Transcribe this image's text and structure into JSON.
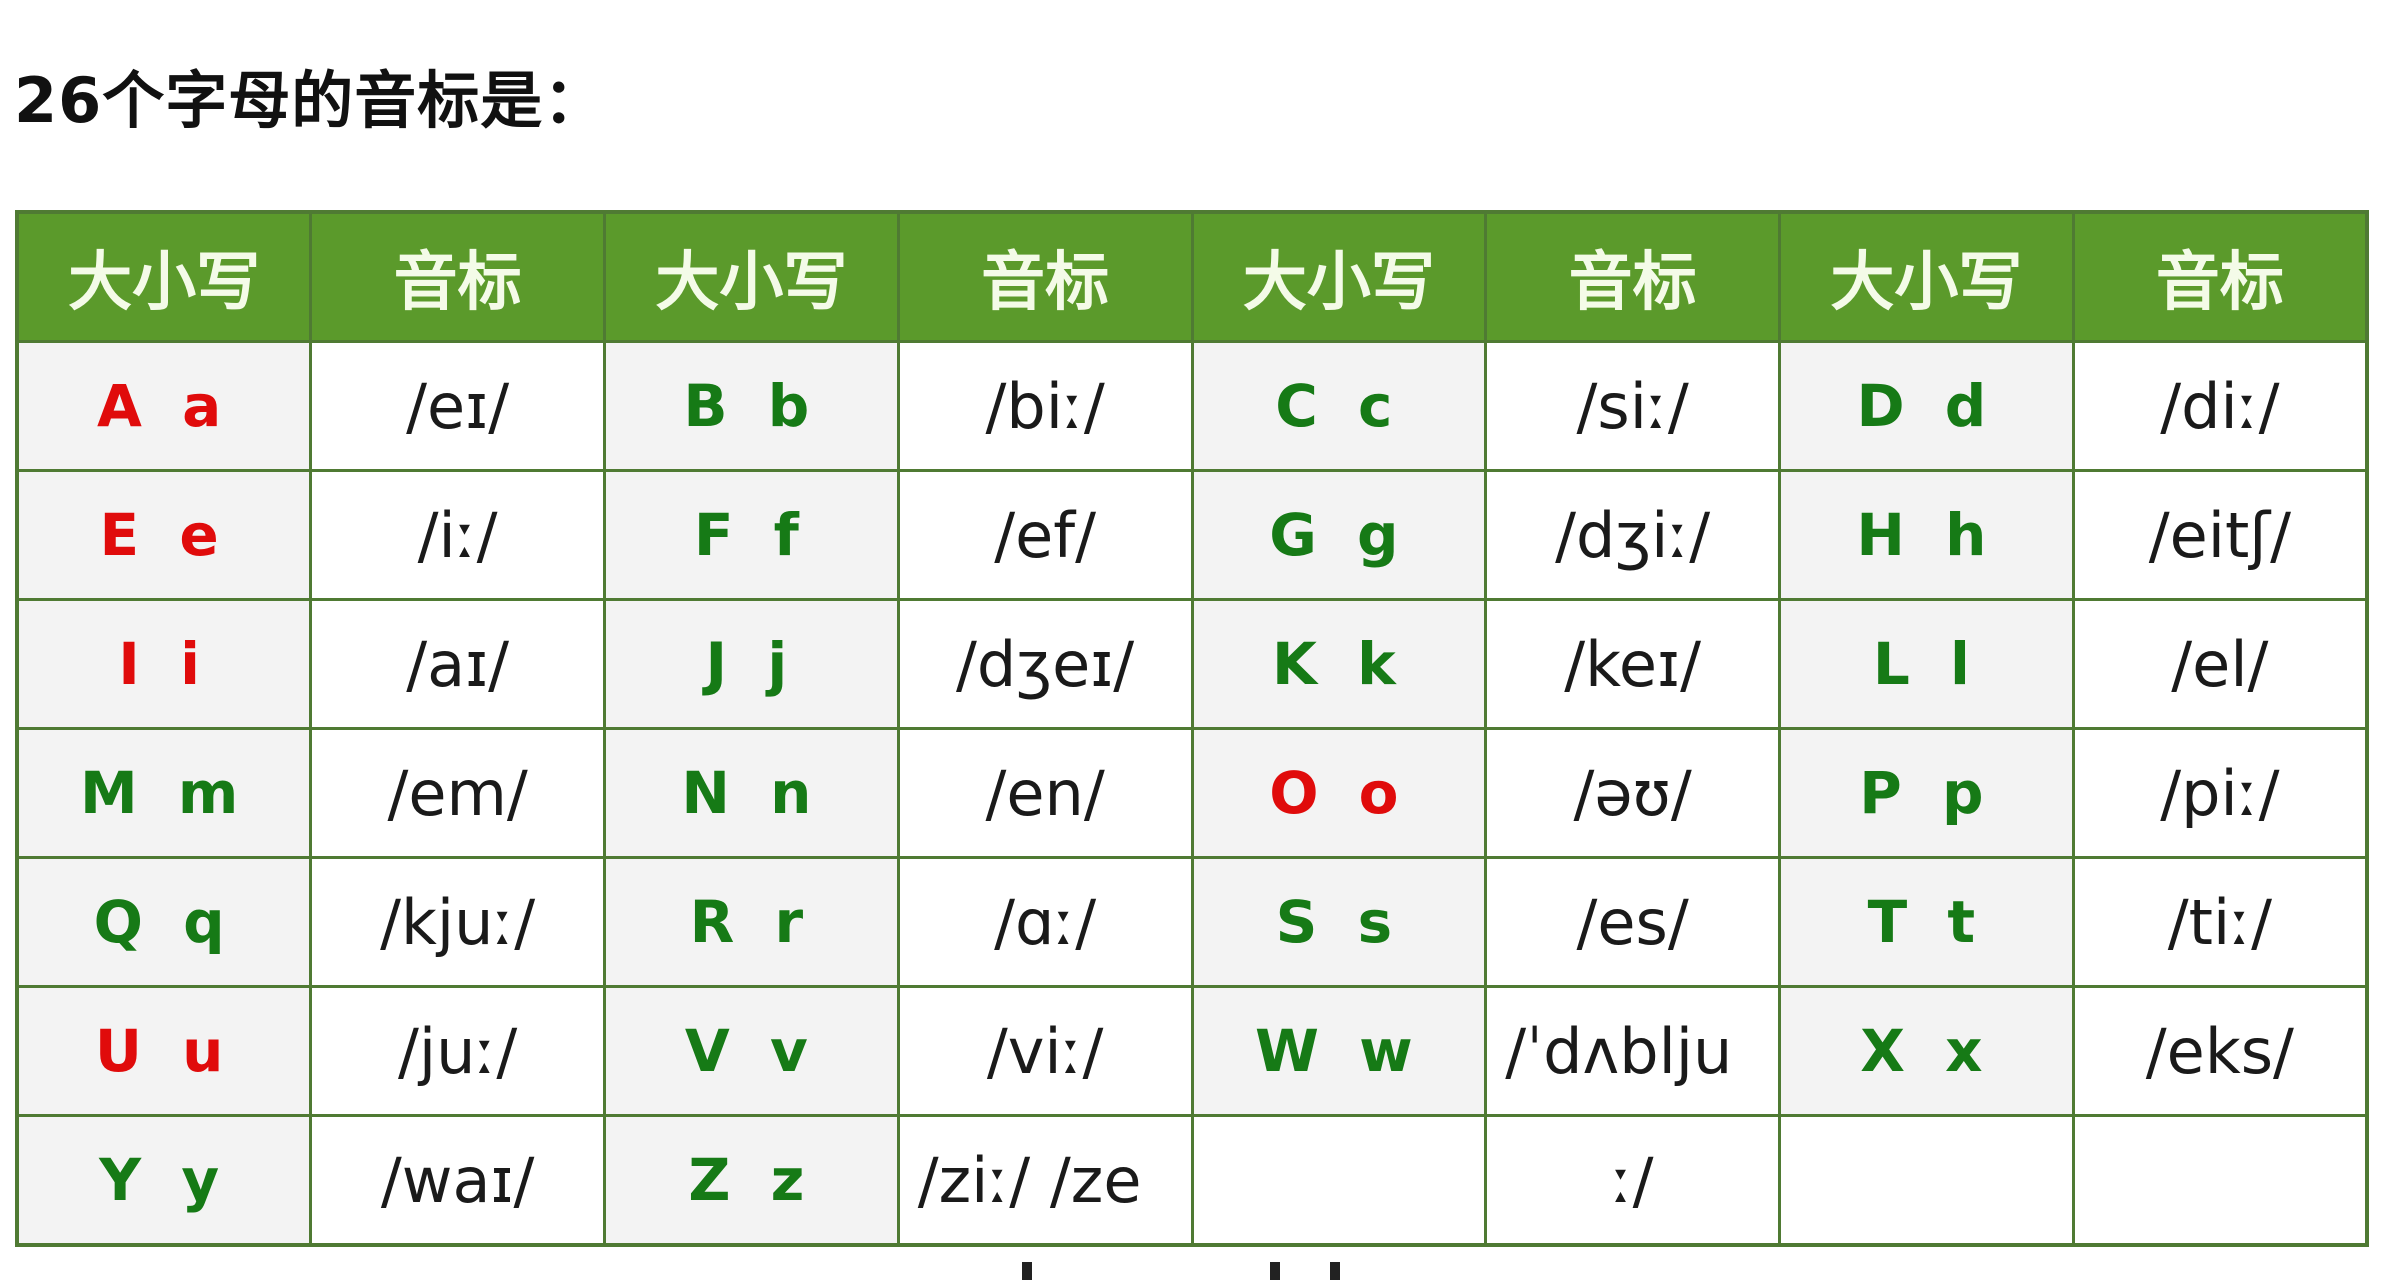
{
  "title": "26个字母的音标是：",
  "table": {
    "headers": [
      "大小写",
      "音标",
      "大小写",
      "音标",
      "大小写",
      "音标",
      "大小写",
      "音标"
    ],
    "rows": [
      [
        {
          "letter": "A a",
          "color": "red",
          "ipa": "/eɪ/"
        },
        {
          "letter": "B b",
          "color": "green",
          "ipa": "/biː/"
        },
        {
          "letter": "C c",
          "color": "green",
          "ipa": "/siː/"
        },
        {
          "letter": "D d",
          "color": "green",
          "ipa": "/diː/"
        }
      ],
      [
        {
          "letter": "E e",
          "color": "red",
          "ipa": "/iː/"
        },
        {
          "letter": "F f",
          "color": "green",
          "ipa": "/ef/"
        },
        {
          "letter": "G g",
          "color": "green",
          "ipa": "/dʒiː/"
        },
        {
          "letter": "H h",
          "color": "green",
          "ipa": "/eitʃ/"
        }
      ],
      [
        {
          "letter": "I i",
          "color": "red",
          "ipa": "/aɪ/"
        },
        {
          "letter": "J j",
          "color": "green",
          "ipa": "/dʒeɪ/"
        },
        {
          "letter": "K k",
          "color": "green",
          "ipa": "/keɪ/"
        },
        {
          "letter": "L l",
          "color": "green",
          "ipa": "/el/"
        }
      ],
      [
        {
          "letter": "M m",
          "color": "green",
          "ipa": "/em/"
        },
        {
          "letter": "N n",
          "color": "green",
          "ipa": "/en/"
        },
        {
          "letter": "O o",
          "color": "red",
          "ipa": "/əʊ/"
        },
        {
          "letter": "P p",
          "color": "green",
          "ipa": "/piː/"
        }
      ],
      [
        {
          "letter": "Q q",
          "color": "green",
          "ipa": "/kjuː/"
        },
        {
          "letter": "R r",
          "color": "green",
          "ipa": "/ɑː/"
        },
        {
          "letter": "S s",
          "color": "green",
          "ipa": "/es/"
        },
        {
          "letter": "T t",
          "color": "green",
          "ipa": "/tiː/"
        }
      ],
      [
        {
          "letter": "U u",
          "color": "red",
          "ipa": "/juː/"
        },
        {
          "letter": "V v",
          "color": "green",
          "ipa": "/viː/"
        },
        {
          "letter": "W w",
          "color": "green",
          "ipa": "/ˈdʌblju"
        },
        {
          "letter": "X x",
          "color": "green",
          "ipa": "/eks/"
        }
      ],
      [
        {
          "letter": "Y y",
          "color": "green",
          "ipa": "/waɪ/"
        },
        {
          "letter": "Z z",
          "color": "green",
          "ipa": "/ziː/ /ze"
        },
        {
          "letter": "",
          "color": "green",
          "ipa": "ː/"
        },
        {
          "letter": "",
          "color": "green",
          "ipa": ""
        }
      ]
    ]
  },
  "colors": {
    "header_bg": "#5b9a2b",
    "border": "#4f7a33",
    "vowel_red": "#e00b0b",
    "consonant_green": "#167a16"
  }
}
